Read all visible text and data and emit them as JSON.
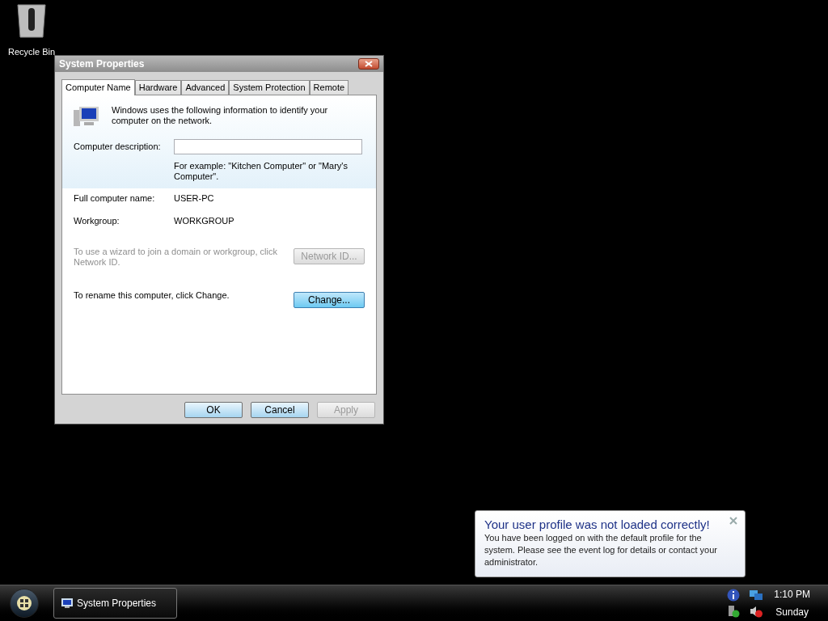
{
  "desktop_icons": [
    {
      "label": "Recycle Bin"
    }
  ],
  "window": {
    "title": "System Properties",
    "tabs": [
      {
        "label": "Computer Name",
        "selected": true
      },
      {
        "label": "Hardware",
        "selected": false
      },
      {
        "label": "Advanced",
        "selected": false
      },
      {
        "label": "System Protection",
        "selected": false
      },
      {
        "label": "Remote",
        "selected": false
      }
    ],
    "intro": "Windows uses the following information to identify your computer on the network.",
    "description_label": "Computer description:",
    "description_hint": "For example: \"Kitchen Computer\" or \"Mary's Computer\".",
    "fields": [
      {
        "label": "Full computer name:",
        "value": "USER-PC"
      },
      {
        "label": "Workgroup:",
        "value": "WORKGROUP"
      }
    ],
    "actions": [
      {
        "text": "To use a wizard to join a domain or workgroup, click Network ID.",
        "button": "Network ID...",
        "disabled": true,
        "focused": false
      },
      {
        "text": "To rename this computer, click Change.",
        "button": "Change...",
        "disabled": false,
        "focused": true
      }
    ],
    "buttons": [
      {
        "label": "OK",
        "disabled": false
      },
      {
        "label": "Cancel",
        "disabled": false
      },
      {
        "label": "Apply",
        "disabled": true
      }
    ]
  },
  "notification": {
    "title": "Your user profile was not loaded correctly!",
    "message": "You have been logged on with the default profile for the system. Please see the event log for details or contact your administrator."
  },
  "taskbar": {
    "tasks": [
      {
        "label": "System Properties"
      }
    ],
    "clock": {
      "time": "1:10 PM",
      "day": "Sunday"
    }
  }
}
